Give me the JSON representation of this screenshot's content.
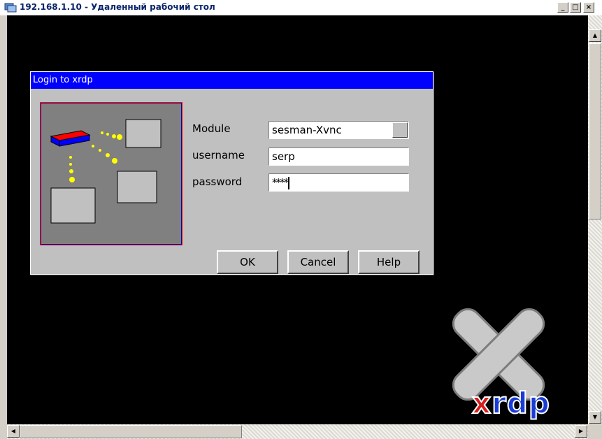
{
  "window": {
    "title": "192.168.1.10 - Удаленный рабочий стол",
    "buttons": {
      "minimize": "_",
      "maximize": "□",
      "close": "×"
    }
  },
  "dialog": {
    "title": "Login to xrdp",
    "fields": {
      "module_label": "Module",
      "module_value": "sesman-Xvnc",
      "username_label": "username",
      "username_value": "serp",
      "password_label": "password",
      "password_value": "****"
    },
    "buttons": {
      "ok": "OK",
      "cancel": "Cancel",
      "help": "Help"
    }
  },
  "brand": {
    "logo_text_x": "x",
    "logo_text_rest": "rdp",
    "colors": {
      "x": "#d61c1c",
      "rdp": "#1a3cd6",
      "dialog_title_bg": "#0000ff"
    }
  }
}
